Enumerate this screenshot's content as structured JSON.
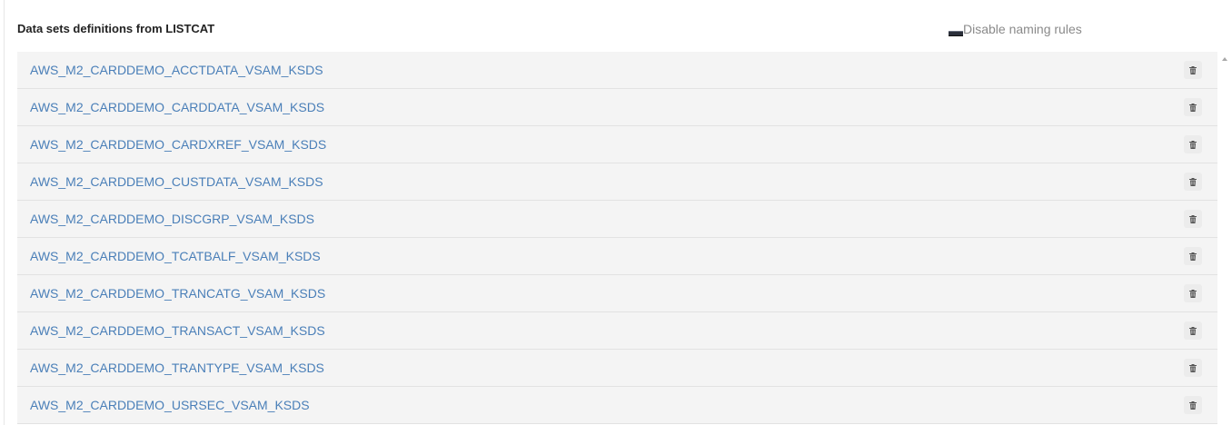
{
  "header": {
    "title": "Data sets definitions from LISTCAT",
    "toggle_label": "Disable naming rules"
  },
  "datasets": [
    {
      "name": "AWS_M2_CARDDEMO_ACCTDATA_VSAM_KSDS"
    },
    {
      "name": "AWS_M2_CARDDEMO_CARDDATA_VSAM_KSDS"
    },
    {
      "name": "AWS_M2_CARDDEMO_CARDXREF_VSAM_KSDS"
    },
    {
      "name": "AWS_M2_CARDDEMO_CUSTDATA_VSAM_KSDS"
    },
    {
      "name": "AWS_M2_CARDDEMO_DISCGRP_VSAM_KSDS"
    },
    {
      "name": "AWS_M2_CARDDEMO_TCATBALF_VSAM_KSDS"
    },
    {
      "name": "AWS_M2_CARDDEMO_TRANCATG_VSAM_KSDS"
    },
    {
      "name": "AWS_M2_CARDDEMO_TRANSACT_VSAM_KSDS"
    },
    {
      "name": "AWS_M2_CARDDEMO_TRANTYPE_VSAM_KSDS"
    },
    {
      "name": "AWS_M2_CARDDEMO_USRSEC_VSAM_KSDS"
    }
  ],
  "icons": {
    "row_action": "trash-icon",
    "toggle": "checkbox-icon",
    "scroll": "scroll-up-arrow-icon"
  },
  "colors": {
    "link": "#4a7fb8",
    "row_background": "#f4f4f4",
    "title": "#222222",
    "toggle_label": "#8a8a8a"
  }
}
